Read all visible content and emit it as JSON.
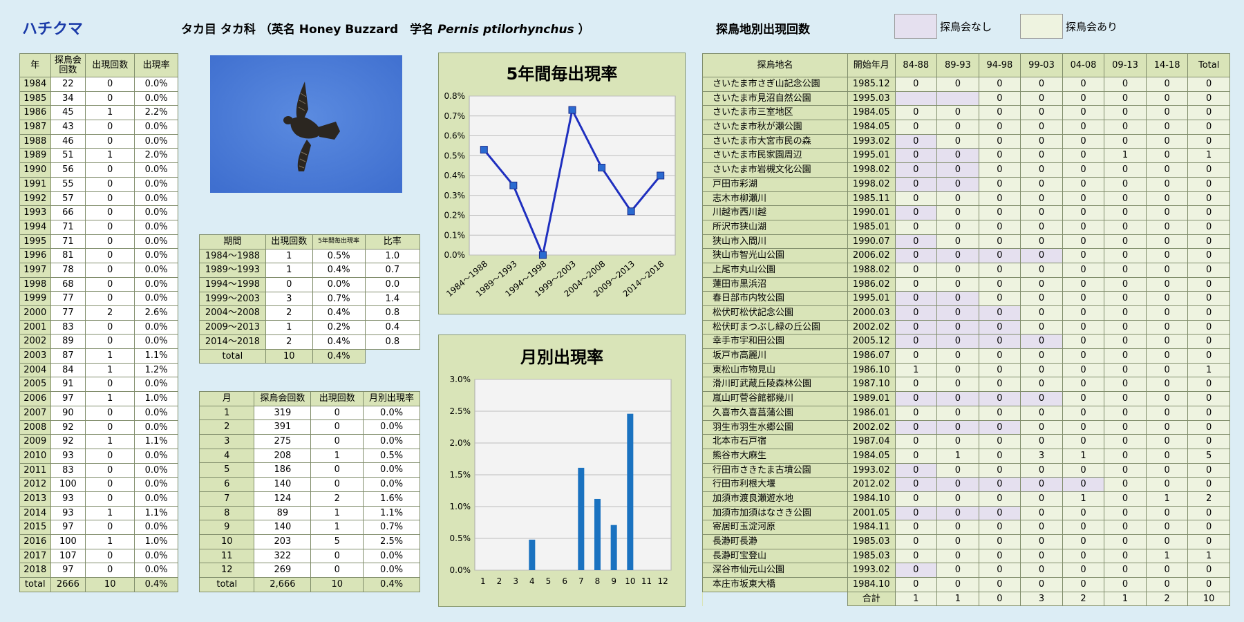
{
  "header": {
    "title": "ハチクマ",
    "taxon_prefix": "タカ目 タカ科 （英名 Honey Buzzard　学名 ",
    "scientific_name": "Pernis ptilorhynchus",
    "taxon_suffix": " ）",
    "region_heading": "探鳥地別出現回数",
    "legend_none": "探鳥会なし",
    "legend_held": "探鳥会あり"
  },
  "colors": {
    "lavender": "#e5e0ef",
    "cream": "#eef3e0",
    "series": "#1f2fbf",
    "bar": "#1a72c0"
  },
  "year_table": {
    "headers": [
      "年",
      "探鳥会\n回数",
      "出現回数",
      "出現率"
    ],
    "rows": [
      [
        "1984",
        "22",
        "0",
        "0.0%"
      ],
      [
        "1985",
        "34",
        "0",
        "0.0%"
      ],
      [
        "1986",
        "45",
        "1",
        "2.2%"
      ],
      [
        "1987",
        "43",
        "0",
        "0.0%"
      ],
      [
        "1988",
        "46",
        "0",
        "0.0%"
      ],
      [
        "1989",
        "51",
        "1",
        "2.0%"
      ],
      [
        "1990",
        "56",
        "0",
        "0.0%"
      ],
      [
        "1991",
        "55",
        "0",
        "0.0%"
      ],
      [
        "1992",
        "57",
        "0",
        "0.0%"
      ],
      [
        "1993",
        "66",
        "0",
        "0.0%"
      ],
      [
        "1994",
        "71",
        "0",
        "0.0%"
      ],
      [
        "1995",
        "71",
        "0",
        "0.0%"
      ],
      [
        "1996",
        "81",
        "0",
        "0.0%"
      ],
      [
        "1997",
        "78",
        "0",
        "0.0%"
      ],
      [
        "1998",
        "68",
        "0",
        "0.0%"
      ],
      [
        "1999",
        "77",
        "0",
        "0.0%"
      ],
      [
        "2000",
        "77",
        "2",
        "2.6%"
      ],
      [
        "2001",
        "83",
        "0",
        "0.0%"
      ],
      [
        "2002",
        "89",
        "0",
        "0.0%"
      ],
      [
        "2003",
        "87",
        "1",
        "1.1%"
      ],
      [
        "2004",
        "84",
        "1",
        "1.2%"
      ],
      [
        "2005",
        "91",
        "0",
        "0.0%"
      ],
      [
        "2006",
        "97",
        "1",
        "1.0%"
      ],
      [
        "2007",
        "90",
        "0",
        "0.0%"
      ],
      [
        "2008",
        "92",
        "0",
        "0.0%"
      ],
      [
        "2009",
        "92",
        "1",
        "1.1%"
      ],
      [
        "2010",
        "93",
        "0",
        "0.0%"
      ],
      [
        "2011",
        "83",
        "0",
        "0.0%"
      ],
      [
        "2012",
        "100",
        "0",
        "0.0%"
      ],
      [
        "2013",
        "93",
        "0",
        "0.0%"
      ],
      [
        "2014",
        "93",
        "1",
        "1.1%"
      ],
      [
        "2015",
        "97",
        "0",
        "0.0%"
      ],
      [
        "2016",
        "100",
        "1",
        "1.0%"
      ],
      [
        "2017",
        "107",
        "0",
        "0.0%"
      ],
      [
        "2018",
        "97",
        "0",
        "0.0%"
      ],
      [
        "total",
        "2666",
        "10",
        "0.4%"
      ]
    ]
  },
  "period_table": {
    "headers": [
      "期間",
      "出現回数",
      "5年間毎出現率",
      "比率"
    ],
    "rows": [
      [
        "1984～1988",
        "1",
        "0.5%",
        "1.0"
      ],
      [
        "1989～1993",
        "1",
        "0.4%",
        "0.7"
      ],
      [
        "1994～1998",
        "0",
        "0.0%",
        "0.0"
      ],
      [
        "1999～2003",
        "3",
        "0.7%",
        "1.4"
      ],
      [
        "2004～2008",
        "2",
        "0.4%",
        "0.8"
      ],
      [
        "2009～2013",
        "1",
        "0.2%",
        "0.4"
      ],
      [
        "2014～2018",
        "2",
        "0.4%",
        "0.8"
      ],
      [
        "total",
        "10",
        "0.4%",
        ""
      ]
    ]
  },
  "month_table": {
    "headers": [
      "月",
      "探鳥会回数",
      "出現回数",
      "月別出現率"
    ],
    "rows": [
      [
        "1",
        "319",
        "0",
        "0.0%"
      ],
      [
        "2",
        "391",
        "0",
        "0.0%"
      ],
      [
        "3",
        "275",
        "0",
        "0.0%"
      ],
      [
        "4",
        "208",
        "1",
        "0.5%"
      ],
      [
        "5",
        "186",
        "0",
        "0.0%"
      ],
      [
        "6",
        "140",
        "0",
        "0.0%"
      ],
      [
        "7",
        "124",
        "2",
        "1.6%"
      ],
      [
        "8",
        "89",
        "1",
        "1.1%"
      ],
      [
        "9",
        "140",
        "1",
        "0.7%"
      ],
      [
        "10",
        "203",
        "5",
        "2.5%"
      ],
      [
        "11",
        "322",
        "0",
        "0.0%"
      ],
      [
        "12",
        "269",
        "0",
        "0.0%"
      ],
      [
        "total",
        "2,666",
        "10",
        "0.4%"
      ]
    ]
  },
  "site_table": {
    "headers": [
      "探鳥地名",
      "開始年月",
      "84-88",
      "89-93",
      "94-98",
      "99-03",
      "04-08",
      "09-13",
      "14-18",
      "Total"
    ],
    "rows": [
      [
        "さいたま市さぎ山記念公園",
        "1985.12",
        "0",
        "0",
        "0",
        "0",
        "0",
        "0",
        "0",
        "0"
      ],
      [
        "さいたま市見沼自然公園",
        "1995.03",
        "",
        "",
        "0",
        "0",
        "0",
        "0",
        "0",
        "0"
      ],
      [
        "さいたま市三室地区",
        "1984.05",
        "0",
        "0",
        "0",
        "0",
        "0",
        "0",
        "0",
        "0"
      ],
      [
        "さいたま市秋が瀬公園",
        "1984.05",
        "0",
        "0",
        "0",
        "0",
        "0",
        "0",
        "0",
        "0"
      ],
      [
        "さいたま市大宮市民の森",
        "1993.02",
        "0",
        "0",
        "0",
        "0",
        "0",
        "0",
        "0",
        "0"
      ],
      [
        "さいたま市民家園周辺",
        "1995.01",
        "0",
        "0",
        "0",
        "0",
        "0",
        "1",
        "0",
        "1"
      ],
      [
        "さいたま市岩槻文化公園",
        "1998.02",
        "0",
        "0",
        "0",
        "0",
        "0",
        "0",
        "0",
        "0"
      ],
      [
        "戸田市彩湖",
        "1998.02",
        "0",
        "0",
        "0",
        "0",
        "0",
        "0",
        "0",
        "0"
      ],
      [
        "志木市柳瀬川",
        "1985.11",
        "0",
        "0",
        "0",
        "0",
        "0",
        "0",
        "0",
        "0"
      ],
      [
        "川越市西川越",
        "1990.01",
        "0",
        "0",
        "0",
        "0",
        "0",
        "0",
        "0",
        "0"
      ],
      [
        "所沢市狭山湖",
        "1985.01",
        "0",
        "0",
        "0",
        "0",
        "0",
        "0",
        "0",
        "0"
      ],
      [
        "狭山市入間川",
        "1990.07",
        "0",
        "0",
        "0",
        "0",
        "0",
        "0",
        "0",
        "0"
      ],
      [
        "狭山市智光山公園",
        "2006.02",
        "0",
        "0",
        "0",
        "0",
        "0",
        "0",
        "0",
        "0"
      ],
      [
        "上尾市丸山公園",
        "1988.02",
        "0",
        "0",
        "0",
        "0",
        "0",
        "0",
        "0",
        "0"
      ],
      [
        "蓮田市黒浜沼",
        "1986.02",
        "0",
        "0",
        "0",
        "0",
        "0",
        "0",
        "0",
        "0"
      ],
      [
        "春日部市内牧公園",
        "1995.01",
        "0",
        "0",
        "0",
        "0",
        "0",
        "0",
        "0",
        "0"
      ],
      [
        "松伏町松伏記念公園",
        "2000.03",
        "0",
        "0",
        "0",
        "0",
        "0",
        "0",
        "0",
        "0"
      ],
      [
        "松伏町まつぶし緑の丘公園",
        "2002.02",
        "0",
        "0",
        "0",
        "0",
        "0",
        "0",
        "0",
        "0"
      ],
      [
        "幸手市宇和田公園",
        "2005.12",
        "0",
        "0",
        "0",
        "0",
        "0",
        "0",
        "0",
        "0"
      ],
      [
        "坂戸市高麗川",
        "1986.07",
        "0",
        "0",
        "0",
        "0",
        "0",
        "0",
        "0",
        "0"
      ],
      [
        "東松山市物見山",
        "1986.10",
        "1",
        "0",
        "0",
        "0",
        "0",
        "0",
        "0",
        "1"
      ],
      [
        "滑川町武蔵丘陵森林公園",
        "1987.10",
        "0",
        "0",
        "0",
        "0",
        "0",
        "0",
        "0",
        "0"
      ],
      [
        "嵐山町菅谷館都幾川",
        "1989.01",
        "0",
        "0",
        "0",
        "0",
        "0",
        "0",
        "0",
        "0"
      ],
      [
        "久喜市久喜菖蒲公園",
        "1986.01",
        "0",
        "0",
        "0",
        "0",
        "0",
        "0",
        "0",
        "0"
      ],
      [
        "羽生市羽生水郷公園",
        "2002.02",
        "0",
        "0",
        "0",
        "0",
        "0",
        "0",
        "0",
        "0"
      ],
      [
        "北本市石戸宿",
        "1987.04",
        "0",
        "0",
        "0",
        "0",
        "0",
        "0",
        "0",
        "0"
      ],
      [
        "熊谷市大麻生",
        "1984.05",
        "0",
        "1",
        "0",
        "3",
        "1",
        "0",
        "0",
        "5"
      ],
      [
        "行田市さきたま古墳公園",
        "1993.02",
        "0",
        "0",
        "0",
        "0",
        "0",
        "0",
        "0",
        "0"
      ],
      [
        "行田市利根大堰",
        "2012.02",
        "0",
        "0",
        "0",
        "0",
        "0",
        "0",
        "0",
        "0"
      ],
      [
        "加須市渡良瀬遊水地",
        "1984.10",
        "0",
        "0",
        "0",
        "0",
        "1",
        "0",
        "1",
        "2"
      ],
      [
        "加須市加須はなさき公園",
        "2001.05",
        "0",
        "0",
        "0",
        "0",
        "0",
        "0",
        "0",
        "0"
      ],
      [
        "寄居町玉淀河原",
        "1984.11",
        "0",
        "0",
        "0",
        "0",
        "0",
        "0",
        "0",
        "0"
      ],
      [
        "長瀞町長瀞",
        "1985.03",
        "0",
        "0",
        "0",
        "0",
        "0",
        "0",
        "0",
        "0"
      ],
      [
        "長瀞町宝登山",
        "1985.03",
        "0",
        "0",
        "0",
        "0",
        "0",
        "0",
        "1",
        "1"
      ],
      [
        "深谷市仙元山公園",
        "1993.02",
        "0",
        "0",
        "0",
        "0",
        "0",
        "0",
        "0",
        "0"
      ],
      [
        "本庄市坂東大橋",
        "1984.10",
        "0",
        "0",
        "0",
        "0",
        "0",
        "0",
        "0",
        "0"
      ]
    ],
    "lavender_cells": [
      [
        1,
        2
      ],
      [
        1,
        3
      ],
      [
        4,
        2
      ],
      [
        5,
        2
      ],
      [
        5,
        3
      ],
      [
        6,
        2
      ],
      [
        6,
        3
      ],
      [
        7,
        2
      ],
      [
        7,
        3
      ],
      [
        9,
        2
      ],
      [
        11,
        2
      ],
      [
        12,
        2
      ],
      [
        12,
        3
      ],
      [
        12,
        4
      ],
      [
        12,
        5
      ],
      [
        15,
        2
      ],
      [
        15,
        3
      ],
      [
        16,
        2
      ],
      [
        16,
        3
      ],
      [
        16,
        4
      ],
      [
        17,
        2
      ],
      [
        17,
        3
      ],
      [
        17,
        4
      ],
      [
        18,
        2
      ],
      [
        18,
        3
      ],
      [
        18,
        4
      ],
      [
        18,
        5
      ],
      [
        22,
        2
      ],
      [
        22,
        3
      ],
      [
        22,
        4
      ],
      [
        22,
        5
      ],
      [
        24,
        2
      ],
      [
        24,
        3
      ],
      [
        24,
        4
      ],
      [
        27,
        2
      ],
      [
        28,
        2
      ],
      [
        28,
        3
      ],
      [
        28,
        4
      ],
      [
        28,
        5
      ],
      [
        28,
        6
      ],
      [
        30,
        2
      ],
      [
        30,
        3
      ],
      [
        30,
        4
      ],
      [
        34,
        2
      ]
    ],
    "total_label": "合計",
    "totals": [
      "1",
      "1",
      "0",
      "3",
      "2",
      "1",
      "2",
      "10"
    ]
  },
  "chart_data": [
    {
      "type": "line",
      "title": "5年間毎出現率",
      "categories": [
        "1984～1988",
        "1989～1993",
        "1994～1998",
        "1999～2003",
        "2004～2008",
        "2009～2013",
        "2014～2018"
      ],
      "values": [
        0.0053,
        0.0035,
        0.0,
        0.0073,
        0.0044,
        0.0022,
        0.004
      ],
      "ylim": [
        0,
        0.008
      ],
      "yticks": [
        "0.0%",
        "0.1%",
        "0.2%",
        "0.3%",
        "0.4%",
        "0.5%",
        "0.6%",
        "0.7%",
        "0.8%"
      ],
      "grid": true
    },
    {
      "type": "bar",
      "title": "月別出現率",
      "categories": [
        "1",
        "2",
        "3",
        "4",
        "5",
        "6",
        "7",
        "8",
        "9",
        "10",
        "11",
        "12"
      ],
      "values": [
        0,
        0,
        0,
        0.0048,
        0,
        0,
        0.0161,
        0.0112,
        0.0071,
        0.0246,
        0,
        0
      ],
      "ylim": [
        0,
        0.03
      ],
      "yticks": [
        "0.0%",
        "0.5%",
        "1.0%",
        "1.5%",
        "2.0%",
        "2.5%",
        "3.0%"
      ],
      "grid": true
    }
  ]
}
